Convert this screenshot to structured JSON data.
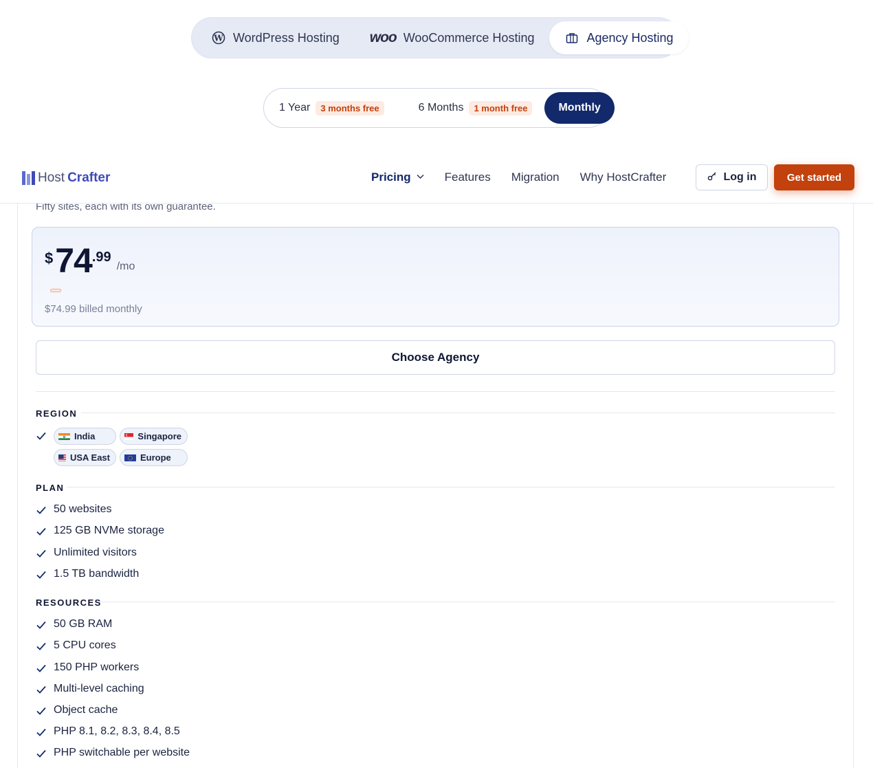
{
  "hosting_tabs": [
    {
      "label": "WordPress Hosting",
      "icon": "wordpress-icon",
      "active": false
    },
    {
      "label": "WooCommerce Hosting",
      "icon": "woo-icon",
      "logo_text": "woo",
      "active": false
    },
    {
      "label": "Agency Hosting",
      "icon": "briefcase-icon",
      "active": true
    }
  ],
  "billing": {
    "options": [
      {
        "label": "1 Year",
        "badge": "3 months free"
      },
      {
        "label": "6 Months",
        "badge": "1 month free"
      },
      {
        "label": "Monthly",
        "badge": ""
      }
    ],
    "selected": "Monthly"
  },
  "nav": {
    "logo_host": "Host",
    "logo_crafter": "Crafter",
    "links": [
      "Pricing",
      "Features",
      "Migration",
      "Why HostCrafter"
    ],
    "active_link": "Pricing",
    "login_label": "Log in",
    "cta_label": "Get started"
  },
  "plan": {
    "tagline": "Fifty sites, each with its own guarantee.",
    "currency": "$",
    "price_int": "74",
    "price_dec": ".99",
    "per": "/mo",
    "billed_note": "$74.99 billed monthly",
    "choose_label": "Choose Agency"
  },
  "sections": {
    "region": {
      "title": "REGION",
      "chips": [
        "India",
        "Singapore",
        "USA East",
        "Europe"
      ]
    },
    "plan": {
      "title": "PLAN",
      "items": [
        "50 websites",
        "125 GB NVMe storage",
        "Unlimited visitors",
        "1.5 TB bandwidth"
      ]
    },
    "resources": {
      "title": "RESOURCES",
      "items": [
        "50 GB RAM",
        "5 CPU cores",
        "150 PHP workers",
        "Multi-level caching",
        "Object cache",
        "PHP 8.1, 8.2, 8.3, 8.4, 8.5",
        "PHP switchable per website"
      ]
    }
  },
  "colors": {
    "brand_navy": "#12296b",
    "accent_orange": "#c2410c",
    "badge_bg": "#fdeae2"
  }
}
